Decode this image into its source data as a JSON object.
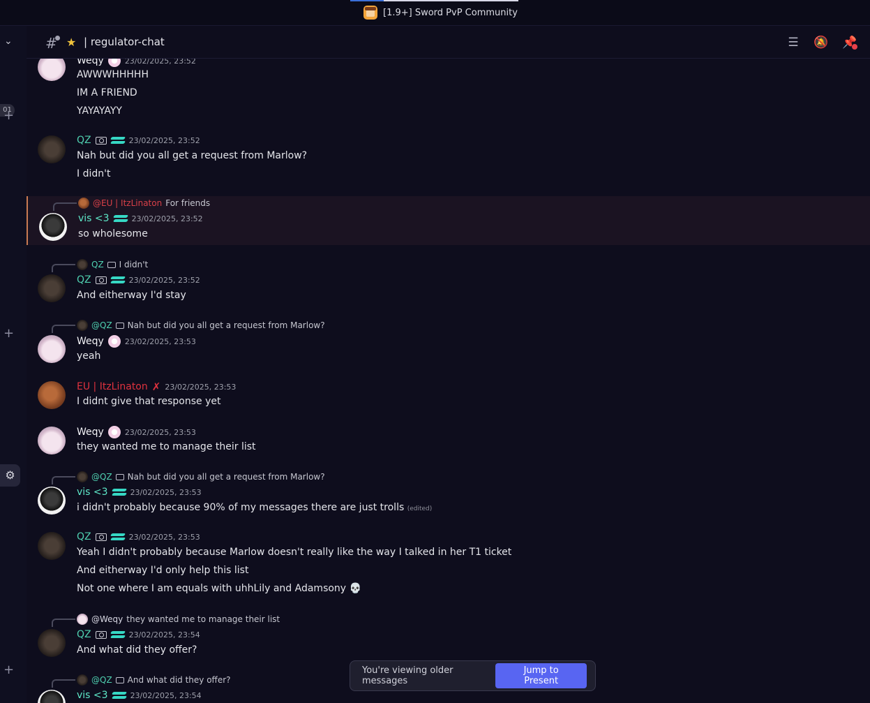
{
  "window": {
    "server_title": "[1.9+] Sword PvP Community"
  },
  "rail": {
    "badge": "01"
  },
  "header": {
    "channel_name": "| regulator-chat"
  },
  "messages": [
    {
      "author": "Weqy",
      "timestamp": "23/02/2025, 23:52",
      "lines": [
        "AWWWHHHHH",
        "IM A FRIEND",
        "YAYAYAYY"
      ]
    },
    {
      "author": "QZ",
      "timestamp": "23/02/2025, 23:52",
      "lines": [
        "Nah but did you all get a request from Marlow?",
        "I didn't"
      ]
    },
    {
      "reply_to": "@EU | ItzLinaton",
      "reply_text": "For friends",
      "author": "vis <3",
      "timestamp": "23/02/2025, 23:52",
      "lines": [
        "so wholesome"
      ]
    },
    {
      "reply_to": "QZ",
      "reply_text": "I didn't",
      "author": "QZ",
      "timestamp": "23/02/2025, 23:52",
      "lines": [
        "And eitherway I'd stay"
      ]
    },
    {
      "reply_to": "@QZ",
      "reply_text": "Nah but did you all get a request from Marlow?",
      "author": "Weqy",
      "timestamp": "23/02/2025, 23:53",
      "lines": [
        "yeah"
      ]
    },
    {
      "author": "EU | ItzLinaton",
      "timestamp": "23/02/2025, 23:53",
      "lines": [
        "I didnt give that response yet"
      ]
    },
    {
      "author": "Weqy",
      "timestamp": "23/02/2025, 23:53",
      "lines": [
        "they wanted me to manage their list"
      ]
    },
    {
      "reply_to": "@QZ",
      "reply_text": "Nah but did you all get a request from Marlow?",
      "author": "vis <3",
      "timestamp": "23/02/2025, 23:53",
      "lines": [
        "i didn't probably because 90% of my messages there are just trolls"
      ],
      "edited": "(edited)"
    },
    {
      "author": "QZ",
      "timestamp": "23/02/2025, 23:53",
      "lines": [
        "Yeah I didn't probably because Marlow doesn't really like the way I talked in her T1 ticket",
        "And eitherway I'd only help this list",
        "Not one where I am equals with uhhLily and Adamsony"
      ]
    },
    {
      "reply_to": "@Weqy",
      "reply_text": "they wanted me to manage their list",
      "author": "QZ",
      "timestamp": "23/02/2025, 23:54",
      "lines": [
        "And what did they offer?"
      ]
    },
    {
      "reply_to": "@QZ",
      "reply_text": "And what did they offer?",
      "author": "vis <3",
      "timestamp": "23/02/2025, 23:54",
      "lines": []
    }
  ],
  "banner": {
    "text": "You're viewing older messages",
    "button": "Jump to Present"
  },
  "colors": {
    "accent": "#5865f2",
    "qz": "#4fd0b0",
    "vis": "#5ee8c8",
    "eu": "#e0323e",
    "highlight_border": "#c97a52"
  }
}
